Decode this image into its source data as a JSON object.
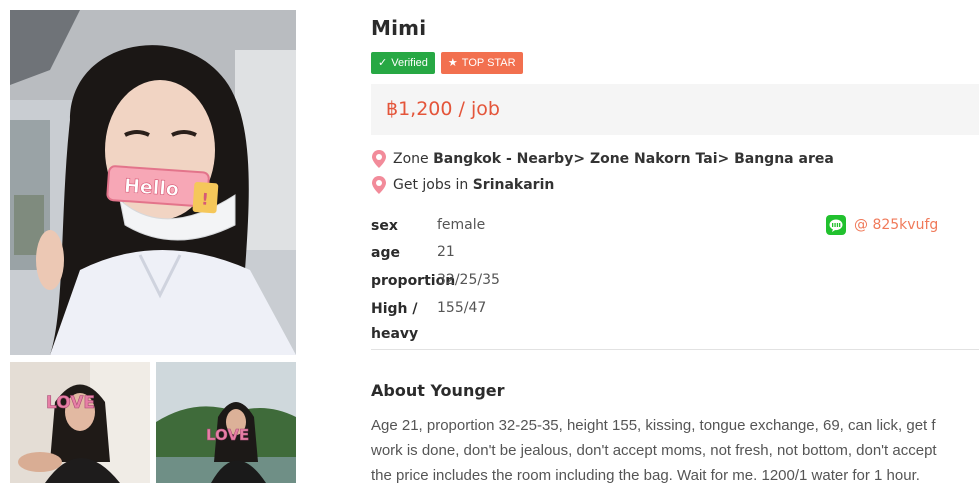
{
  "profile": {
    "name": "Mimi",
    "badge_verified": "Verified",
    "badge_topstar": "TOP STAR",
    "price": "฿1,200 / job",
    "zone_prefix": "Zone ",
    "zone": "Bangkok - Nearby> Zone Nakorn Tai> Bangna area",
    "jobs_prefix": "Get jobs in ",
    "jobs_area": "Srinakarin"
  },
  "photo": {
    "sticker_text": "Hello",
    "thumb1_text": "LOVE",
    "thumb2_text": "LOVE"
  },
  "attributes": {
    "sex_label": "sex",
    "sex_value": "female",
    "age_label": "age",
    "age_value": "21",
    "proportion_label": "proportion",
    "proportion_value": "32/25/35",
    "height_label_1": "High /",
    "height_label_2": "heavy",
    "height_value": "155/47"
  },
  "contact": {
    "line_id": "@ 825kvufg"
  },
  "about": {
    "title": "About Younger",
    "lines": [
      "Age 21, proportion 32-25-35, height 155, kissing, tongue exchange, 69, can lick, get f",
      "work is done, don't be jealous, don't accept moms, not fresh, not bottom, don't accept",
      "the price includes the room including the bag. Wait for me. 1200/1 water for 1 hour."
    ]
  },
  "colors": {
    "accent": "#e4553a",
    "verified": "#27a844",
    "topstar": "#f2704f",
    "line": "#21c12e"
  },
  "icons": [
    "location-pin-icon",
    "check-icon",
    "star-icon",
    "line-app-icon"
  ]
}
